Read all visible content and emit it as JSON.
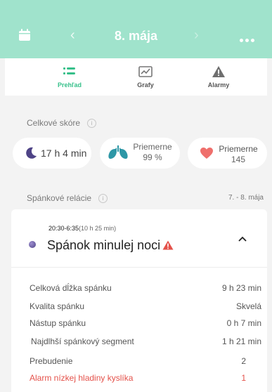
{
  "header": {
    "date": "8. mája",
    "prev": "‹",
    "next": "›"
  },
  "tabs": [
    {
      "label": "Prehľad",
      "icon": "list-icon",
      "active": true
    },
    {
      "label": "Grafy",
      "icon": "chart-icon",
      "active": false
    },
    {
      "label": "Alarmy",
      "icon": "alert-triangle-icon",
      "active": false
    }
  ],
  "score": {
    "title": "Celkové skóre",
    "info": "i",
    "sleep_duration": "17 h 4 min",
    "oxygen_label": "Priemerne",
    "oxygen_value": "99 %",
    "heart_label": "Priemerne",
    "heart_value": "145"
  },
  "sessions": {
    "title": "Spánkové relácie",
    "info": "i",
    "date_range": "7. - 8. mája",
    "card": {
      "time": "20:30-6:35",
      "duration": "(10 h 25 min)",
      "title": "Spánok minulej noci"
    },
    "rows": [
      {
        "label": "Celková dĺžka spánku",
        "value": "9 h 23 min"
      },
      {
        "label": "Kvalita spánku",
        "value": "Skvelá"
      },
      {
        "label": "Nástup spánku",
        "value": "0 h 7 min"
      },
      {
        "label": "Najdlhší spánkový segment",
        "value": "1 h 21 min"
      },
      {
        "label": "Prebudenie",
        "value": "2"
      },
      {
        "label": "Alarm nízkej hladiny kyslíka",
        "value": "1"
      }
    ]
  },
  "colors": {
    "header_bg": "#a0e3cc",
    "active_tab": "#36c08a",
    "alert": "#e4514a",
    "moon": "#4e4386",
    "lungs": "#2d97a6",
    "heart": "#ef6f6c"
  }
}
